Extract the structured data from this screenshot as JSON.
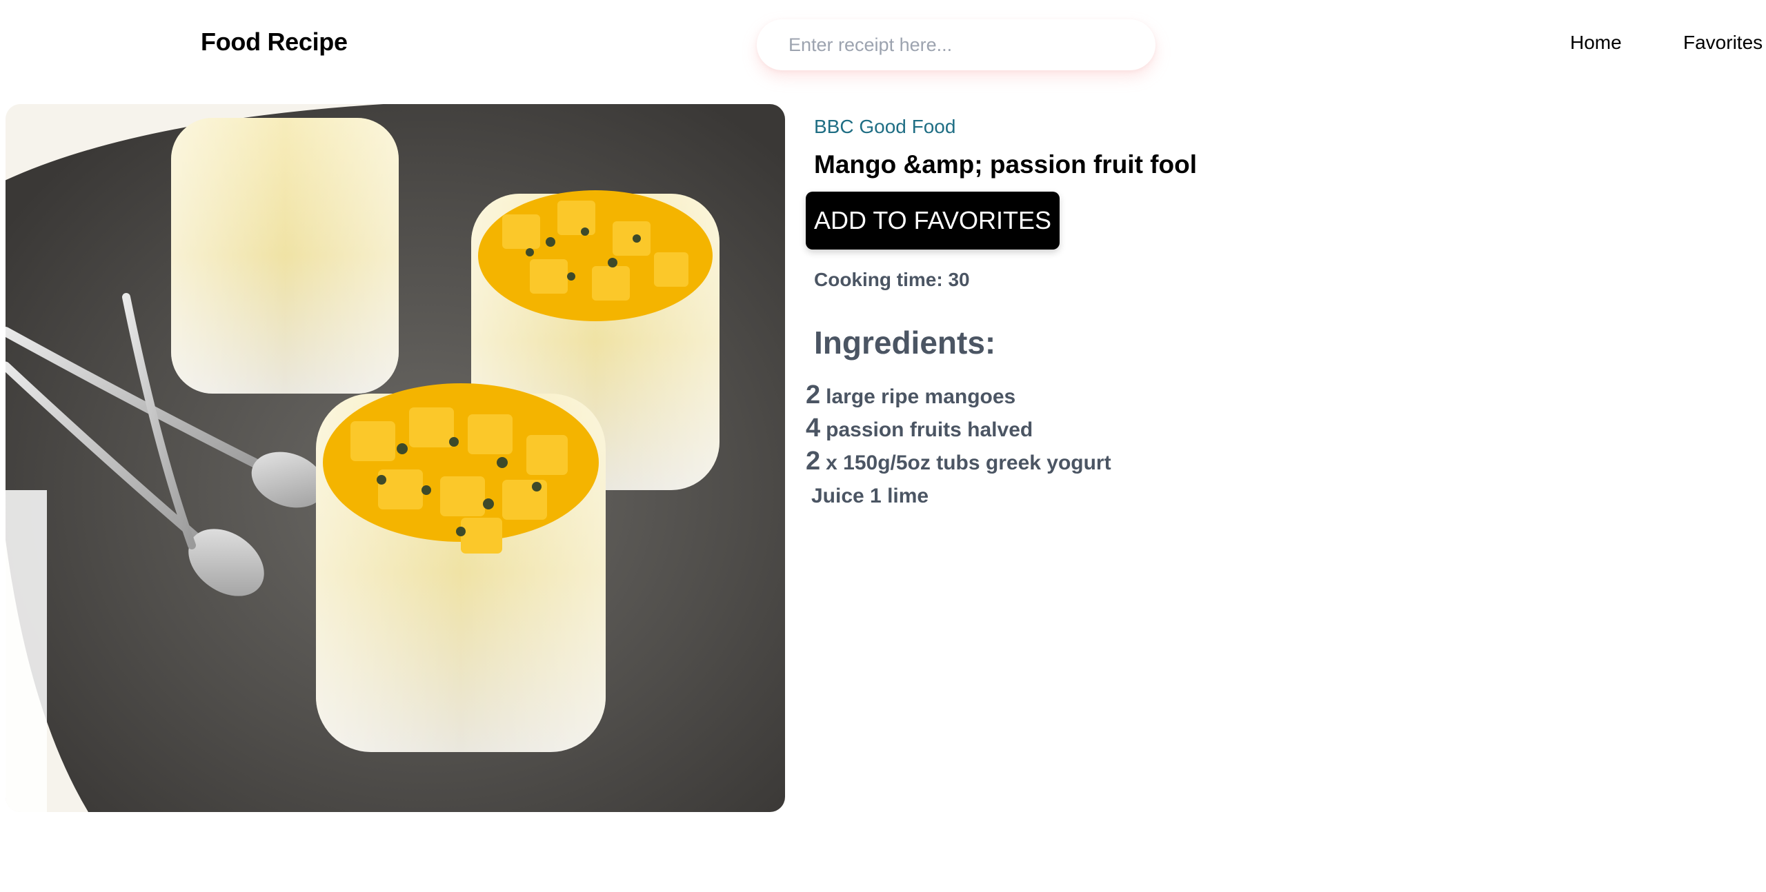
{
  "header": {
    "brand": "Food Recipe",
    "search_placeholder": "Enter receipt here...",
    "search_value": "",
    "nav": {
      "home": "Home",
      "favorites": "Favorites"
    }
  },
  "recipe": {
    "publisher": "BBC Good Food",
    "title": "Mango &amp; passion fruit fool",
    "add_favorite_label": "ADD TO FAVORITES",
    "cooking_time": "Cooking time: 30",
    "ingredients_heading": "Ingredients:",
    "ingredients": [
      {
        "qty": "2",
        "text": "large ripe mangoes"
      },
      {
        "qty": "4",
        "text": "passion fruits halved"
      },
      {
        "qty": "2",
        "text": "x 150g/5oz tubs greek yogurt"
      },
      {
        "qty": "",
        "text": "Juice 1 lime"
      }
    ]
  },
  "colors": {
    "publisher": "#1f6e84",
    "muted_text": "#4b5563",
    "button_bg": "#000000",
    "button_text": "#ffffff",
    "search_shadow": "#faa"
  }
}
